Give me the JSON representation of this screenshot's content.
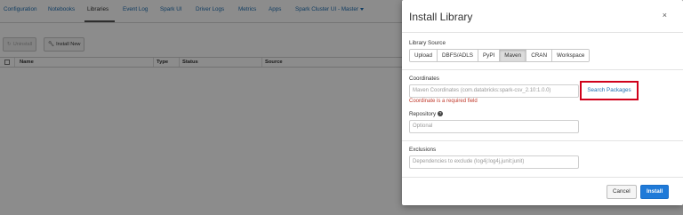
{
  "nav": {
    "tabs": [
      {
        "label": "Configuration"
      },
      {
        "label": "Notebooks"
      },
      {
        "label": "Libraries"
      },
      {
        "label": "Event Log"
      },
      {
        "label": "Spark UI"
      },
      {
        "label": "Driver Logs"
      },
      {
        "label": "Metrics"
      },
      {
        "label": "Apps"
      },
      {
        "label": "Spark Cluster UI - Master"
      }
    ],
    "active_tab": "Libraries"
  },
  "toolbar": {
    "uninstall_label": "Uninstall",
    "install_new_label": "Install New"
  },
  "table": {
    "columns": [
      "Name",
      "Type",
      "Status",
      "Source"
    ]
  },
  "modal": {
    "title": "Install Library",
    "close_glyph": "×",
    "library_source": {
      "label": "Library Source",
      "options": [
        "Upload",
        "DBFS/ADLS",
        "PyPI",
        "Maven",
        "CRAN",
        "Workspace"
      ],
      "selected": "Maven"
    },
    "coordinates": {
      "label": "Coordinates",
      "placeholder": "Maven Coordinates (com.databricks:spark-csv_2.10:1.0.0)",
      "error": "Coordinate is a required field",
      "search_label": "Search Packages"
    },
    "repository": {
      "label": "Repository",
      "help_glyph": "?",
      "placeholder": "Optional"
    },
    "exclusions": {
      "label": "Exclusions",
      "placeholder": "Dependencies to exclude (log4j:log4j,junit:junit)"
    },
    "cancel_label": "Cancel",
    "install_label": "Install"
  },
  "colors": {
    "link": "#1f6fb2",
    "error": "#c0392b",
    "highlight_box": "#d0021b",
    "primary_button": "#1f7ad8"
  }
}
